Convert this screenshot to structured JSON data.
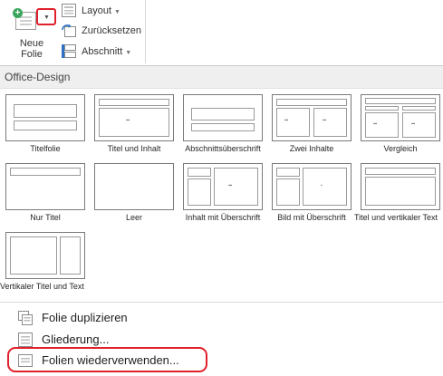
{
  "ribbon": {
    "new_slide_label": "Neue Folie",
    "layout_label": "Layout",
    "reset_label": "Zurücksetzen",
    "section_label": "Abschnitt"
  },
  "gallery": {
    "section_title": "Office-Design",
    "layouts": [
      {
        "name": "Titelfolie"
      },
      {
        "name": "Titel und Inhalt"
      },
      {
        "name": "Abschnittsüberschrift"
      },
      {
        "name": "Zwei Inhalte"
      },
      {
        "name": "Vergleich"
      },
      {
        "name": "Nur Titel"
      },
      {
        "name": "Leer"
      },
      {
        "name": "Inhalt mit Überschrift"
      },
      {
        "name": "Bild mit Überschrift"
      },
      {
        "name": "Titel und vertikaler Text"
      },
      {
        "name": "Vertikaler Titel und Text"
      }
    ]
  },
  "menu": {
    "duplicate": "Folie duplizieren",
    "outline": "Gliederung...",
    "reuse": "Folien wiederverwenden..."
  },
  "colors": {
    "highlight": "#e0202a",
    "plus_icon": "#3aa55d"
  }
}
